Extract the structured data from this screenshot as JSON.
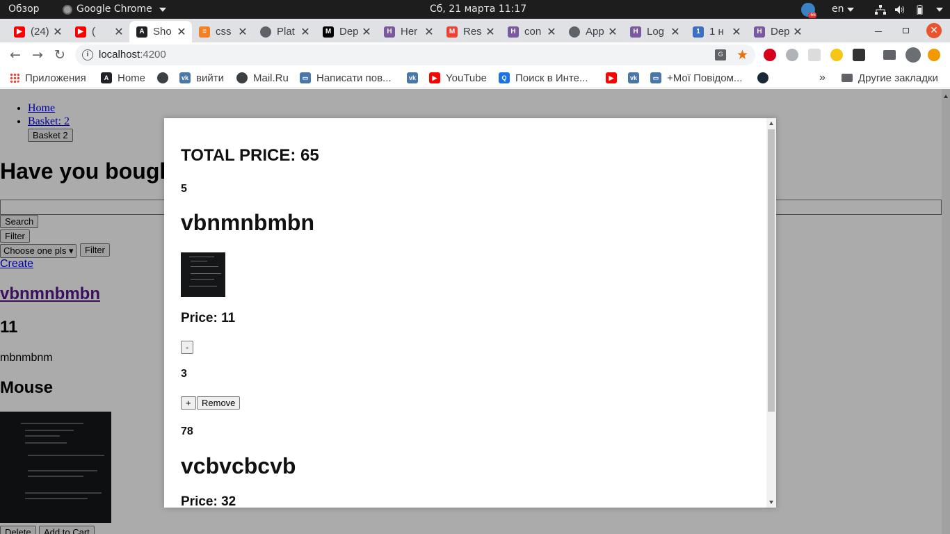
{
  "system_bar": {
    "activities": "Обзор",
    "app_name": "Google Chrome",
    "clock": "Сб, 21 марта  11:17",
    "lang": "en"
  },
  "tabs": [
    {
      "title": "(24)",
      "favicon": "youtube-icon",
      "color": "#ff0000"
    },
    {
      "title": "(",
      "favicon": "youtube-icon",
      "color": "#ff0000"
    },
    {
      "title": "Sho",
      "favicon": "angular-icon",
      "color": "#202124",
      "active": true
    },
    {
      "title": "css",
      "favicon": "stackoverflow-icon",
      "color": "#f48024"
    },
    {
      "title": "Plat",
      "favicon": "globe-icon",
      "color": "#5f6368"
    },
    {
      "title": "Dep",
      "favicon": "medium-icon",
      "color": "#000000"
    },
    {
      "title": "Her",
      "favicon": "heroku-icon",
      "color": "#79589f"
    },
    {
      "title": "Res",
      "favicon": "gmail-icon",
      "color": "#ea4335"
    },
    {
      "title": "con",
      "favicon": "heroku-icon",
      "color": "#79589f"
    },
    {
      "title": "App",
      "favicon": "globe-icon",
      "color": "#5f6368"
    },
    {
      "title": "Log",
      "favicon": "heroku-icon",
      "color": "#79589f"
    },
    {
      "title": "1 н",
      "favicon": "number-one-icon",
      "color": "#3b6fc4"
    },
    {
      "title": "Dep",
      "favicon": "heroku-icon",
      "color": "#79589f"
    }
  ],
  "address_bar": {
    "host": "localhost",
    "port": ":4200"
  },
  "bookmarks": [
    {
      "label": "Приложения",
      "icon": "apps-grid-icon"
    },
    {
      "label": "Home",
      "icon": "angular-icon"
    },
    {
      "label": "",
      "icon": "globe-icon"
    },
    {
      "label": "вийти",
      "icon": "vk-icon"
    },
    {
      "label": "Mail.Ru",
      "icon": "globe-icon"
    },
    {
      "label": "Написати пов...",
      "icon": "chat-icon"
    },
    {
      "label": "",
      "icon": "vk-icon"
    },
    {
      "label": "YouTube",
      "icon": "youtube-icon"
    },
    {
      "label": "Поиск в Инте...",
      "icon": "search-engine-icon"
    },
    {
      "label": "",
      "icon": "youtube-icon"
    },
    {
      "label": "",
      "icon": "vk-icon"
    },
    {
      "label": "+Мої Повідом...",
      "icon": "chat-icon"
    },
    {
      "label": "",
      "icon": "steam-icon"
    }
  ],
  "bookmarks_more": "»",
  "other_bookmarks": "Другие закладки",
  "page": {
    "nav": {
      "home": "Home",
      "basket": "Basket: 2"
    },
    "basket_button": "Basket 2",
    "heading": "Have you bought",
    "search_button": "Search",
    "filter_button_1": "Filter",
    "select_value": "Choose one pls",
    "filter_button_2": "Filter",
    "create_link": "Create",
    "product": {
      "title": "vbnmnbmbn",
      "price": "11",
      "description": "mbnmbnm",
      "category": "Mouse",
      "delete": "Delete",
      "add_to_cart": "Add to Cart"
    }
  },
  "modal": {
    "total": "TOTAL PRICE: 65",
    "items": [
      {
        "id": "5",
        "name": "vbnmnbmbn",
        "price": "Price: 11",
        "minus": "-",
        "quantity": "3",
        "plus": "+",
        "remove": "Remove"
      },
      {
        "id": "78",
        "name": "vcbvcbcvb",
        "price": "Price: 32"
      }
    ]
  },
  "colors": {
    "overlay": "#000000",
    "link": "#0000ee",
    "visited_link": "#551a8b",
    "accent_close": "#e9542e"
  }
}
